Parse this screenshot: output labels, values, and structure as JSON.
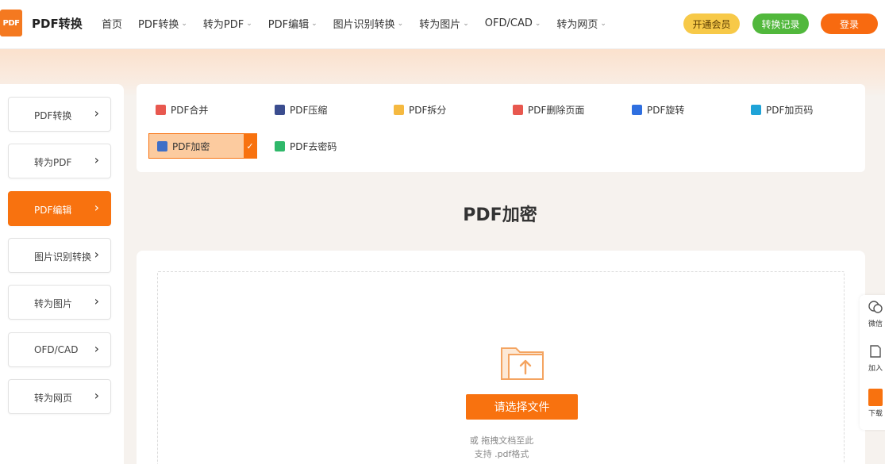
{
  "header": {
    "logo_text": "PDF",
    "brand": "PDF转换",
    "nav": [
      {
        "label": "首页",
        "has_menu": false
      },
      {
        "label": "PDF转换",
        "has_menu": true
      },
      {
        "label": "转为PDF",
        "has_menu": true
      },
      {
        "label": "PDF编辑",
        "has_menu": true
      },
      {
        "label": "图片识别转换",
        "has_menu": true
      },
      {
        "label": "转为图片",
        "has_menu": true
      },
      {
        "label": "OFD/CAD",
        "has_menu": true
      },
      {
        "label": "转为网页",
        "has_menu": true
      }
    ],
    "vip_label": "开通会员",
    "record_label": "转换记录",
    "login_label": "登录"
  },
  "sidebar": {
    "items": [
      {
        "label": "PDF转换",
        "active": false
      },
      {
        "label": "转为PDF",
        "active": false
      },
      {
        "label": "PDF编辑",
        "active": true
      },
      {
        "label": "图片识别转换",
        "active": false
      },
      {
        "label": "转为图片",
        "active": false
      },
      {
        "label": "OFD/CAD",
        "active": false
      },
      {
        "label": "转为网页",
        "active": false
      }
    ]
  },
  "tools": [
    {
      "label": "PDF合并",
      "icon": "merge-icon",
      "color": "#e8584f"
    },
    {
      "label": "PDF压缩",
      "icon": "compress-icon",
      "color": "#3b4d8f"
    },
    {
      "label": "PDF拆分",
      "icon": "split-icon",
      "color": "#f5b940"
    },
    {
      "label": "PDF删除页面",
      "icon": "delete-page-icon",
      "color": "#e8584f"
    },
    {
      "label": "PDF旋转",
      "icon": "rotate-icon",
      "color": "#2f6fe0"
    },
    {
      "label": "PDF加页码",
      "icon": "page-number-icon",
      "color": "#1fa3d8"
    },
    {
      "label": "PDF加密",
      "icon": "lock-icon",
      "color": "#3f6fc7",
      "selected": true
    },
    {
      "label": "PDF去密码",
      "icon": "unlock-icon",
      "color": "#2fb86a"
    }
  ],
  "page_title": "PDF加密",
  "upload": {
    "button_label": "请选择文件",
    "hint_drag": "或 拖拽文档至此",
    "hint_format": "支持 .pdf格式"
  },
  "float_bar": {
    "items": [
      {
        "label": "微信",
        "icon": "wechat-icon"
      },
      {
        "label": "加入",
        "icon": "bookmark-icon"
      },
      {
        "label": "下载",
        "icon": "download-app-icon"
      }
    ]
  },
  "colors": {
    "accent": "#f8720f",
    "vip": "#f7c948",
    "record": "#51b83c"
  }
}
